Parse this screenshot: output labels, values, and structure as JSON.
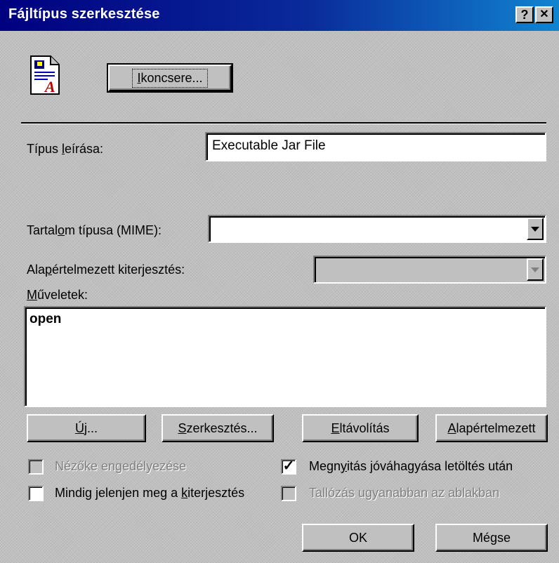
{
  "window": {
    "title": "Fájltípus szerkesztése",
    "help_glyph": "?",
    "close_glyph": "✕"
  },
  "icon_change_button": {
    "pre": "",
    "mn": "I",
    "post": "koncsere..."
  },
  "type_description": {
    "label_pre": "Típus ",
    "label_mn": "l",
    "label_post": "eírása:",
    "value": "Executable Jar File"
  },
  "mime": {
    "label_pre": "Tartal",
    "label_mn": "o",
    "label_post": "m típusa (MIME):",
    "value": ""
  },
  "default_extension": {
    "label_pre": "Ala",
    "label_mn": "p",
    "label_post": "értelmezett kiterjesztés:",
    "value": ""
  },
  "actions": {
    "label_pre": "",
    "label_mn": "M",
    "label_post": "űveletek:",
    "items": [
      "open"
    ]
  },
  "buttons": {
    "new": {
      "pre": "",
      "mn": "Ú",
      "post": "j..."
    },
    "edit": {
      "pre": "",
      "mn": "S",
      "post": "zerkesztés..."
    },
    "remove": {
      "pre": "",
      "mn": "E",
      "post": "ltávolítás"
    },
    "set_default": {
      "pre": "",
      "mn": "A",
      "post": "lapértelmezett"
    },
    "ok": "OK",
    "cancel": "Mégse"
  },
  "options": {
    "viewer": {
      "label": "Nézőke engedélyezése",
      "checked": false,
      "enabled": false
    },
    "confirm_open": {
      "pre": "Megn",
      "mn": "y",
      "post": "itás jóváhagyása letöltés után",
      "checked": true,
      "enabled": true
    },
    "always_show_ext": {
      "pre": "Mindig jelenjen meg a ",
      "mn": "k",
      "post": "iterjesztés",
      "checked": false,
      "enabled": true
    },
    "browse_same": {
      "label": "Tallózás ugyanabban az ablakban",
      "checked": false,
      "enabled": false
    }
  },
  "checkmark_glyph": "✓"
}
